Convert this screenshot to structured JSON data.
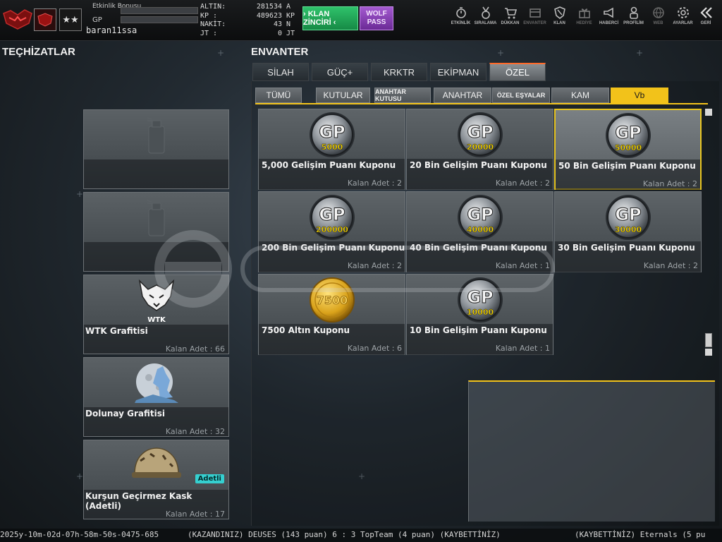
{
  "topbar": {
    "username": "baran11ssa",
    "etkinlik_label": "Etkinlik Bonusu",
    "gp_label": "GP",
    "etkinlik_fill": 0,
    "gp_fill": 0,
    "currencies": [
      {
        "key": "ALTIN:",
        "value": "281534",
        "unit": "A"
      },
      {
        "key": "KP :",
        "value": "489623",
        "unit": "KP"
      },
      {
        "key": "NAKİT:",
        "value": "43",
        "unit": "N"
      },
      {
        "key": "JT :",
        "value": "0",
        "unit": "JT"
      }
    ],
    "klan_label": "› KLAN ZİNCİRİ ‹",
    "wolf_label": "WOLF PASS",
    "nav": [
      {
        "label": "ETKİNLİK",
        "icon": "stopwatch-icon"
      },
      {
        "label": "SIRALAMA",
        "icon": "medal-icon"
      },
      {
        "label": "DÜKKAN",
        "icon": "cart-icon"
      },
      {
        "label": "ENVANTER",
        "icon": "inventory-icon"
      },
      {
        "label": "KLAN",
        "icon": "shield-icon"
      },
      {
        "label": "HEDİYE",
        "icon": "gift-icon"
      },
      {
        "label": "HABERCİ",
        "icon": "megaphone-icon"
      },
      {
        "label": "PROFİLİM",
        "icon": "profile-icon"
      },
      {
        "label": "WEB",
        "icon": "globe-icon"
      },
      {
        "label": "AYARLAR",
        "icon": "gear-icon"
      },
      {
        "label": "GERİ",
        "icon": "back-icon"
      }
    ]
  },
  "left": {
    "title": "TEÇHİZATLAR",
    "items": [
      {
        "name": "",
        "count": "",
        "icon": "spray-can-icon"
      },
      {
        "name": "",
        "count": "",
        "icon": "spray-can-icon"
      },
      {
        "name": "WTK Grafitisi",
        "count": "Kalan Adet : 66",
        "icon": "wolf-graffiti-icon"
      },
      {
        "name": "Dolunay Grafitisi",
        "count": "Kalan Adet : 32",
        "icon": "full-moon-graffiti-icon"
      },
      {
        "name": "Kurşun Geçirmez Kask (Adetli)",
        "count": "Kalan Adet : 17",
        "icon": "helmet-icon",
        "badge": "Adetli"
      }
    ]
  },
  "inventory": {
    "title": "ENVANTER",
    "main_tabs": [
      "SİLAH",
      "GÜÇ+",
      "KRKTR",
      "EKİPMAN",
      "ÖZEL"
    ],
    "active_main_tab": 4,
    "sub_tabs": [
      "TÜMÜ",
      "KUTULAR",
      "ANAHTAR KUTUSU",
      "ANAHTAR",
      "ÖZEL EŞYALAR",
      "KAM",
      "Vb"
    ],
    "active_sub_tab": 6,
    "items": [
      {
        "name": "5,000 Gelişim Puanı Kuponu",
        "count": "Kalan Adet : 2",
        "badge": "GP",
        "amount": "5000",
        "type": "gp"
      },
      {
        "name": "20 Bin Gelişim Puanı Kuponu",
        "count": "Kalan Adet : 2",
        "badge": "GP",
        "amount": "20000",
        "type": "gp"
      },
      {
        "name": "50 Bin Gelişim Puanı Kuponu",
        "count": "Kalan Adet : 2",
        "badge": "GP",
        "amount": "50000",
        "type": "gp",
        "selected": true
      },
      {
        "name": "200 Bin Gelişim Puanı Kuponu",
        "count": "Kalan Adet : 2",
        "badge": "GP",
        "amount": "200000",
        "type": "gp"
      },
      {
        "name": "40 Bin Gelişim Puanı Kuponu",
        "count": "Kalan Adet : 1",
        "badge": "GP",
        "amount": "40000",
        "type": "gp"
      },
      {
        "name": "30 Bin Gelişim Puanı Kuponu",
        "count": "Kalan Adet : 2",
        "badge": "GP",
        "amount": "30000",
        "type": "gp"
      },
      {
        "name": "7500 Altın Kuponu",
        "count": "Kalan Adet : 6",
        "badge": "",
        "amount": "7500",
        "type": "gold"
      },
      {
        "name": "10 Bin Gelişim Puanı Kuponu",
        "count": "Kalan Adet : 1",
        "badge": "GP",
        "amount": "10000",
        "type": "gp"
      }
    ]
  },
  "ticker": {
    "left": "2025y-10m-02d-07h-58m-50s-0475-685",
    "middle": "(KAZANDINIZ) DEUSES (143 puan) 6 : 3 TopTeam (4 puan) (KAYBETTİNİZ)",
    "right": "(KAYBETTİNİZ) Eternals (5 pu"
  },
  "colors": {
    "accent_yellow": "#f2c21a",
    "tab_orange": "#ff6a2a",
    "klan_green": "#1fa855",
    "wolf_purple": "#8a3fb8"
  }
}
